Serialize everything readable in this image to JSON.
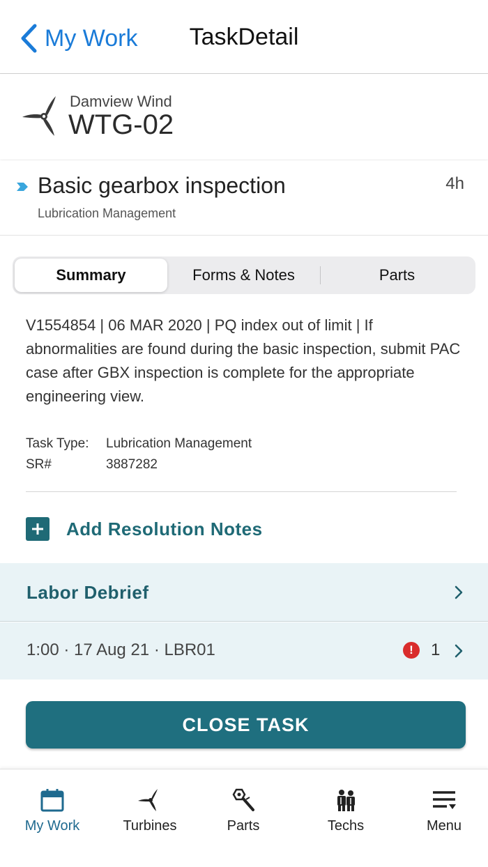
{
  "nav": {
    "back_label": "My Work",
    "title": "TaskDetail"
  },
  "turbine": {
    "site": "Damview Wind",
    "id": "WTG-02"
  },
  "task": {
    "title": "Basic gearbox inspection",
    "subtitle": "Lubrication Management",
    "duration": "4h"
  },
  "tabs": [
    {
      "label": "Summary",
      "active": true
    },
    {
      "label": "Forms & Notes",
      "active": false
    },
    {
      "label": "Parts",
      "active": false
    }
  ],
  "summary": {
    "description": "V1554854 | 06 MAR 2020 | PQ index out of limit | If abnormalities are found during the basic inspection, submit PAC case after GBX inspection is complete for the appropriate engineering view.",
    "task_type_label": "Task Type:",
    "task_type_value": "Lubrication Management",
    "sr_label": "SR#",
    "sr_value": "3887282",
    "add_notes_label": "Add Resolution Notes"
  },
  "labor": {
    "title": "Labor Debrief",
    "entry": "1:00 · 17 Aug 21 · LBR01",
    "error_glyph": "!",
    "count": "1"
  },
  "close_task_label": "CLOSE TASK",
  "bottom_nav": [
    {
      "label": "My Work",
      "icon": "calendar-icon",
      "active": true
    },
    {
      "label": "Turbines",
      "icon": "turbine-icon",
      "active": false
    },
    {
      "label": "Parts",
      "icon": "wrench-nut-icon",
      "active": false
    },
    {
      "label": "Techs",
      "icon": "technicians-icon",
      "active": false
    },
    {
      "label": "Menu",
      "icon": "menu-icon",
      "active": false
    }
  ],
  "colors": {
    "accent_blue": "#1a7bd8",
    "teal": "#1f6a76",
    "button_teal": "#1f6f7f",
    "light_teal_bg": "#e9f3f6",
    "error_red": "#d92c2c"
  }
}
